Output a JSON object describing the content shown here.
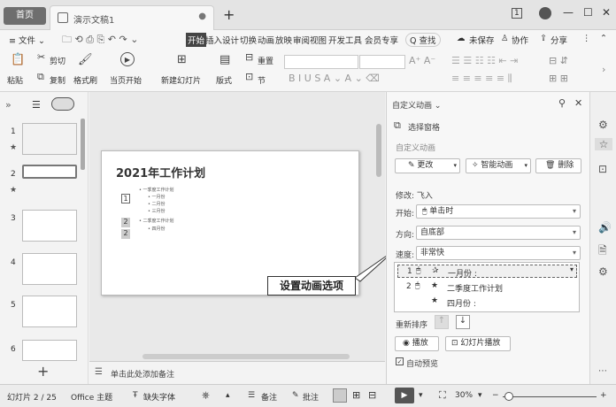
{
  "tabs": {
    "home": "首页",
    "doc": "演示文稿1",
    "doc_dot": "●",
    "new": "+"
  },
  "window": {
    "badge": "1",
    "min": "—",
    "max": "☐",
    "close": "✕"
  },
  "menu": {
    "file": "≡ 文件 ⌄",
    "items": [
      "开始",
      "插入",
      "设计",
      "切换",
      "动画",
      "放映",
      "审阅",
      "视图",
      "开发工具",
      "会员专享"
    ],
    "search": "Q 查找",
    "unsaved": "未保存",
    "collab": "协作",
    "share": "分享"
  },
  "ribbon": {
    "paste": "粘贴",
    "cut": "剪切",
    "copy": "复制",
    "format_painter": "格式刷",
    "play_from_start": "当页开始",
    "new_slide": "新建幻灯片",
    "layout": "版式",
    "section": "节",
    "reset": "重置"
  },
  "thumbnails": [
    {
      "num": "1"
    },
    {
      "num": "2"
    },
    {
      "num": "3"
    },
    {
      "num": "4"
    },
    {
      "num": "5"
    },
    {
      "num": "6"
    }
  ],
  "slide": {
    "title": "2021年工作计划",
    "b1": "• 一季度工作计划",
    "b1a": "• 一月份",
    "b1b": "• 二月份",
    "b1c": "• 三月份",
    "b2": "• 二季度工作计划",
    "b2a": "• 四月份",
    "n1": "1",
    "n2": "2",
    "n3": "2"
  },
  "callout": "设置动画选项",
  "notes": "单击此处添加备注",
  "pane": {
    "title": "自定义动画 ⌄",
    "select_pane": "选择窗格",
    "section": "自定义动画",
    "change": "更改",
    "smart": "智能动画",
    "delete": "删除",
    "modify": "修改: 飞入",
    "start_label": "开始:",
    "start_value": "单击时",
    "dir_label": "方向:",
    "dir_value": "自底部",
    "speed_label": "速度:",
    "speed_value": "非常快",
    "list": [
      {
        "idx": "1",
        "text": "一月份 :"
      },
      {
        "idx": "2",
        "text": "二季度工作计划"
      },
      {
        "idx": "",
        "text": "四月份 :"
      }
    ],
    "reorder": "重新排序",
    "play": "播放",
    "slideshow": "幻灯片播放",
    "autopreview": "自动预览"
  },
  "status": {
    "slide": "幻灯片 2 / 25",
    "theme": "Office 主题",
    "font": "缺失字体",
    "notes": "备注",
    "comments": "批注",
    "zoom": "30%"
  }
}
